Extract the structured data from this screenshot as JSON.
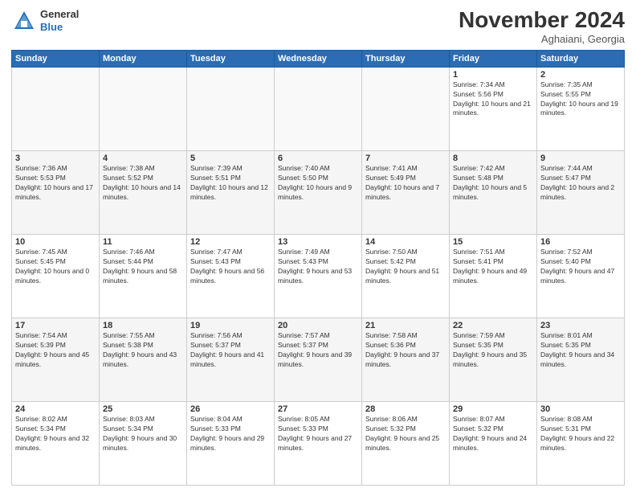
{
  "header": {
    "logo_general": "General",
    "logo_blue": "Blue",
    "month_title": "November 2024",
    "location": "Aghaiani, Georgia"
  },
  "weekdays": [
    "Sunday",
    "Monday",
    "Tuesday",
    "Wednesday",
    "Thursday",
    "Friday",
    "Saturday"
  ],
  "weeks": [
    [
      {
        "day": "",
        "sunrise": "",
        "sunset": "",
        "daylight": ""
      },
      {
        "day": "",
        "sunrise": "",
        "sunset": "",
        "daylight": ""
      },
      {
        "day": "",
        "sunrise": "",
        "sunset": "",
        "daylight": ""
      },
      {
        "day": "",
        "sunrise": "",
        "sunset": "",
        "daylight": ""
      },
      {
        "day": "",
        "sunrise": "",
        "sunset": "",
        "daylight": ""
      },
      {
        "day": "1",
        "sunrise": "Sunrise: 7:34 AM",
        "sunset": "Sunset: 5:56 PM",
        "daylight": "Daylight: 10 hours and 21 minutes."
      },
      {
        "day": "2",
        "sunrise": "Sunrise: 7:35 AM",
        "sunset": "Sunset: 5:55 PM",
        "daylight": "Daylight: 10 hours and 19 minutes."
      }
    ],
    [
      {
        "day": "3",
        "sunrise": "Sunrise: 7:36 AM",
        "sunset": "Sunset: 5:53 PM",
        "daylight": "Daylight: 10 hours and 17 minutes."
      },
      {
        "day": "4",
        "sunrise": "Sunrise: 7:38 AM",
        "sunset": "Sunset: 5:52 PM",
        "daylight": "Daylight: 10 hours and 14 minutes."
      },
      {
        "day": "5",
        "sunrise": "Sunrise: 7:39 AM",
        "sunset": "Sunset: 5:51 PM",
        "daylight": "Daylight: 10 hours and 12 minutes."
      },
      {
        "day": "6",
        "sunrise": "Sunrise: 7:40 AM",
        "sunset": "Sunset: 5:50 PM",
        "daylight": "Daylight: 10 hours and 9 minutes."
      },
      {
        "day": "7",
        "sunrise": "Sunrise: 7:41 AM",
        "sunset": "Sunset: 5:49 PM",
        "daylight": "Daylight: 10 hours and 7 minutes."
      },
      {
        "day": "8",
        "sunrise": "Sunrise: 7:42 AM",
        "sunset": "Sunset: 5:48 PM",
        "daylight": "Daylight: 10 hours and 5 minutes."
      },
      {
        "day": "9",
        "sunrise": "Sunrise: 7:44 AM",
        "sunset": "Sunset: 5:47 PM",
        "daylight": "Daylight: 10 hours and 2 minutes."
      }
    ],
    [
      {
        "day": "10",
        "sunrise": "Sunrise: 7:45 AM",
        "sunset": "Sunset: 5:45 PM",
        "daylight": "Daylight: 10 hours and 0 minutes."
      },
      {
        "day": "11",
        "sunrise": "Sunrise: 7:46 AM",
        "sunset": "Sunset: 5:44 PM",
        "daylight": "Daylight: 9 hours and 58 minutes."
      },
      {
        "day": "12",
        "sunrise": "Sunrise: 7:47 AM",
        "sunset": "Sunset: 5:43 PM",
        "daylight": "Daylight: 9 hours and 56 minutes."
      },
      {
        "day": "13",
        "sunrise": "Sunrise: 7:49 AM",
        "sunset": "Sunset: 5:43 PM",
        "daylight": "Daylight: 9 hours and 53 minutes."
      },
      {
        "day": "14",
        "sunrise": "Sunrise: 7:50 AM",
        "sunset": "Sunset: 5:42 PM",
        "daylight": "Daylight: 9 hours and 51 minutes."
      },
      {
        "day": "15",
        "sunrise": "Sunrise: 7:51 AM",
        "sunset": "Sunset: 5:41 PM",
        "daylight": "Daylight: 9 hours and 49 minutes."
      },
      {
        "day": "16",
        "sunrise": "Sunrise: 7:52 AM",
        "sunset": "Sunset: 5:40 PM",
        "daylight": "Daylight: 9 hours and 47 minutes."
      }
    ],
    [
      {
        "day": "17",
        "sunrise": "Sunrise: 7:54 AM",
        "sunset": "Sunset: 5:39 PM",
        "daylight": "Daylight: 9 hours and 45 minutes."
      },
      {
        "day": "18",
        "sunrise": "Sunrise: 7:55 AM",
        "sunset": "Sunset: 5:38 PM",
        "daylight": "Daylight: 9 hours and 43 minutes."
      },
      {
        "day": "19",
        "sunrise": "Sunrise: 7:56 AM",
        "sunset": "Sunset: 5:37 PM",
        "daylight": "Daylight: 9 hours and 41 minutes."
      },
      {
        "day": "20",
        "sunrise": "Sunrise: 7:57 AM",
        "sunset": "Sunset: 5:37 PM",
        "daylight": "Daylight: 9 hours and 39 minutes."
      },
      {
        "day": "21",
        "sunrise": "Sunrise: 7:58 AM",
        "sunset": "Sunset: 5:36 PM",
        "daylight": "Daylight: 9 hours and 37 minutes."
      },
      {
        "day": "22",
        "sunrise": "Sunrise: 7:59 AM",
        "sunset": "Sunset: 5:35 PM",
        "daylight": "Daylight: 9 hours and 35 minutes."
      },
      {
        "day": "23",
        "sunrise": "Sunrise: 8:01 AM",
        "sunset": "Sunset: 5:35 PM",
        "daylight": "Daylight: 9 hours and 34 minutes."
      }
    ],
    [
      {
        "day": "24",
        "sunrise": "Sunrise: 8:02 AM",
        "sunset": "Sunset: 5:34 PM",
        "daylight": "Daylight: 9 hours and 32 minutes."
      },
      {
        "day": "25",
        "sunrise": "Sunrise: 8:03 AM",
        "sunset": "Sunset: 5:34 PM",
        "daylight": "Daylight: 9 hours and 30 minutes."
      },
      {
        "day": "26",
        "sunrise": "Sunrise: 8:04 AM",
        "sunset": "Sunset: 5:33 PM",
        "daylight": "Daylight: 9 hours and 29 minutes."
      },
      {
        "day": "27",
        "sunrise": "Sunrise: 8:05 AM",
        "sunset": "Sunset: 5:33 PM",
        "daylight": "Daylight: 9 hours and 27 minutes."
      },
      {
        "day": "28",
        "sunrise": "Sunrise: 8:06 AM",
        "sunset": "Sunset: 5:32 PM",
        "daylight": "Daylight: 9 hours and 25 minutes."
      },
      {
        "day": "29",
        "sunrise": "Sunrise: 8:07 AM",
        "sunset": "Sunset: 5:32 PM",
        "daylight": "Daylight: 9 hours and 24 minutes."
      },
      {
        "day": "30",
        "sunrise": "Sunrise: 8:08 AM",
        "sunset": "Sunset: 5:31 PM",
        "daylight": "Daylight: 9 hours and 22 minutes."
      }
    ]
  ]
}
